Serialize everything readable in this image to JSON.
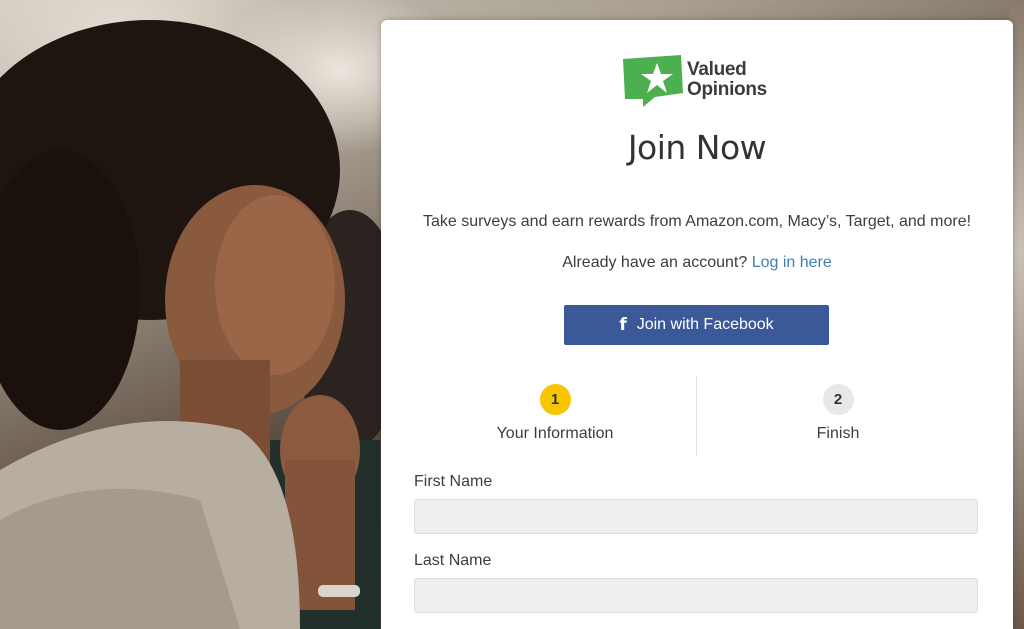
{
  "brand": {
    "name_line1": "Valued",
    "name_line2": "Opinions",
    "logo_color": "#4caf50"
  },
  "signup": {
    "title": "Join Now",
    "tagline": "Take surveys and earn rewards from Amazon.com, Macy’s, Target, and more!",
    "login_prompt": "Already have an account?",
    "login_link": "Log in here",
    "facebook_button": "Join with Facebook",
    "facebook_icon": "facebook-f-icon",
    "facebook_color": "#3b5998",
    "link_color": "#3f7fb3"
  },
  "steps": [
    {
      "number": "1",
      "label": "Your Information",
      "state": "active",
      "color": "#f6c700"
    },
    {
      "number": "2",
      "label": "Finish",
      "state": "inactive",
      "color": "#e8e8e8"
    }
  ],
  "form": {
    "first_name": {
      "label": "First Name",
      "value": "",
      "placeholder": ""
    },
    "last_name": {
      "label": "Last Name",
      "value": "",
      "placeholder": ""
    }
  }
}
